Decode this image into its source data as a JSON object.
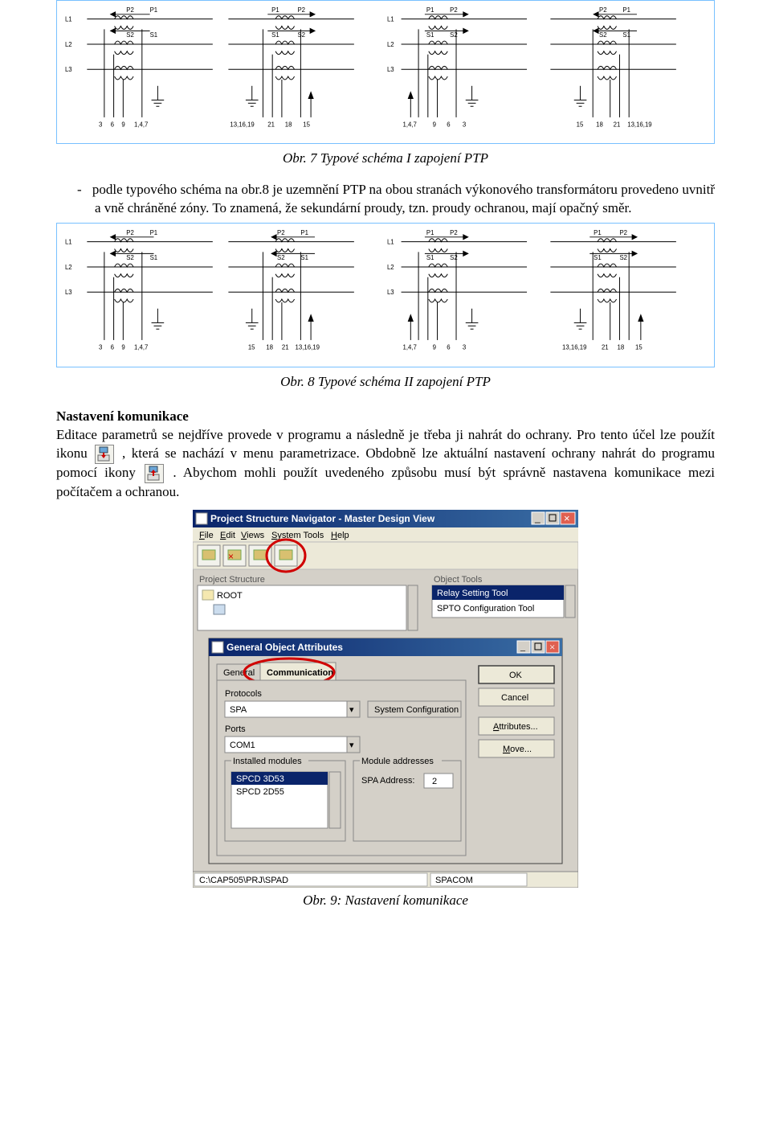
{
  "figure7": {
    "caption": "Obr. 7 Typové schéma I zapojení PTP",
    "leftLabels": [
      "L1",
      "L2",
      "L3"
    ],
    "diagrams": [
      {
        "secTop": [
          "P2",
          "P1"
        ],
        "arrowTop": "r->l",
        "secBot": [
          "S2",
          "S1"
        ],
        "priTop": [
          "P1",
          "P2"
        ],
        "arrowTop2": "l->r",
        "priBot": [
          "S1",
          "S2"
        ],
        "terms": [
          "3",
          "6",
          "9",
          "1,4,7"
        ],
        "termsR": [
          "13,16,19",
          "21",
          "18",
          "15"
        ]
      },
      {}
    ],
    "row1_terms_left": "3   6   9  1,4,7",
    "row1_terms_mid": "13,16,19 21  18   15",
    "row1_terms_right_l": "1,4,7   9    6    3",
    "row1_terms_right_r": "15   18   21 13,16,19"
  },
  "bullet": {
    "dash": "-",
    "text": "podle typového schéma na obr.8 je uzemnění PTP na obou stranách výkonového transformátoru provedeno uvnitř a vně chráněné zóny. To znamená, že sekundární proudy, tzn. proudy ochranou, mají opačný směr."
  },
  "figure8": {
    "caption": "Obr. 8 Typové schéma II zapojení PTP",
    "row1_terms_left": "3   6   9  1,4,7",
    "row1_terms_mid": "15  18  21 13,16,19",
    "row1_terms_right_l": "1,4,7   9    6    3",
    "row1_terms_right_r": "13,16,19  21  18   15"
  },
  "section_heading": "Nastavení komunikace",
  "para1": "Editace parametrů se nejdříve provede v programu a následně je třeba ji nahrát do ochrany. Pro tento účel lze použít ikonu ",
  "para1b": ", která se nachází v menu parametrizace. Obdobně lze aktuální nastavení ochrany nahrát do programu pomocí ikony ",
  "para1c": ". Abychom mohli použít uvedeného způsobu musí být správně nastavena komunikace mezi počítačem a ochranou.",
  "screenshot": {
    "navigator_title": "Project Structure Navigator - Master Design View",
    "menus": [
      "File",
      "Edit",
      "Views",
      "System Tools",
      "Help"
    ],
    "project_structure_label": "Project Structure",
    "root": "ROOT",
    "object_tools_label": "Object Tools",
    "tools": [
      "Relay Setting Tool",
      "SPTO Configuration Tool"
    ],
    "attr_title": "General Object Attributes",
    "tabs": [
      "General",
      "Communication"
    ],
    "protocols_label": "Protocols",
    "protocol_value": "SPA",
    "sysconf_btn": "System Configuration",
    "ports_label": "Ports",
    "ports_value": "COM1",
    "installed_label": "Installed modules",
    "installed_items": [
      "SPCD 3D53",
      "SPCD 2D55"
    ],
    "module_addr_label": "Module addresses",
    "spa_addr_label": "SPA Address:",
    "spa_addr_value": "2",
    "buttons": [
      "OK",
      "Cancel",
      "Attributes...",
      "Move..."
    ],
    "status_left": "C:\\CAP505\\PRJ\\SPAD",
    "status_right": "SPACOM"
  },
  "figure9_caption": "Obr. 9: Nastavení komunikace"
}
